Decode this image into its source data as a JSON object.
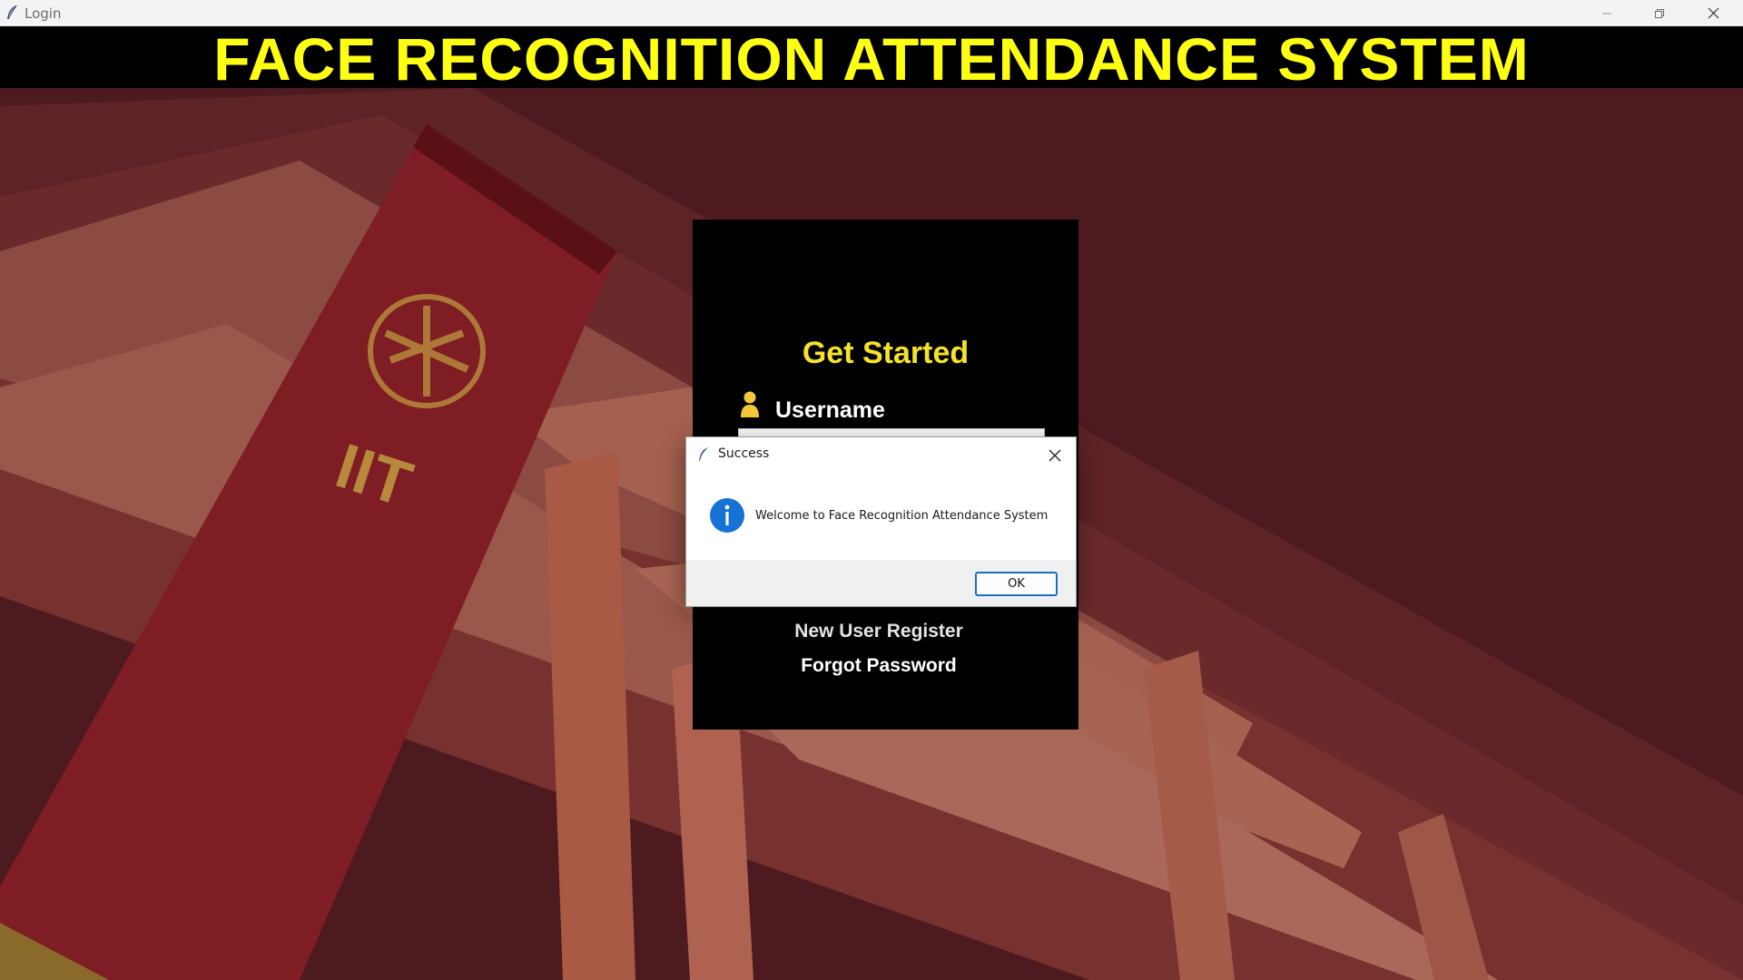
{
  "window": {
    "title": "Login"
  },
  "banner": {
    "title": "FACE RECOGNITION ATTENDANCE SYSTEM",
    "color": "#ffff14"
  },
  "background": {
    "emblem_text": "IIT"
  },
  "login": {
    "heading": "Get Started",
    "username_label": "Username",
    "username_value": "",
    "register_link": "New User Register",
    "forgot_link": "Forgot Password"
  },
  "dialog": {
    "title": "Success",
    "message": "Welcome to Face Recognition Attendance System",
    "ok_label": "OK",
    "icon": "info-icon",
    "accent": "#1c6fc7"
  }
}
